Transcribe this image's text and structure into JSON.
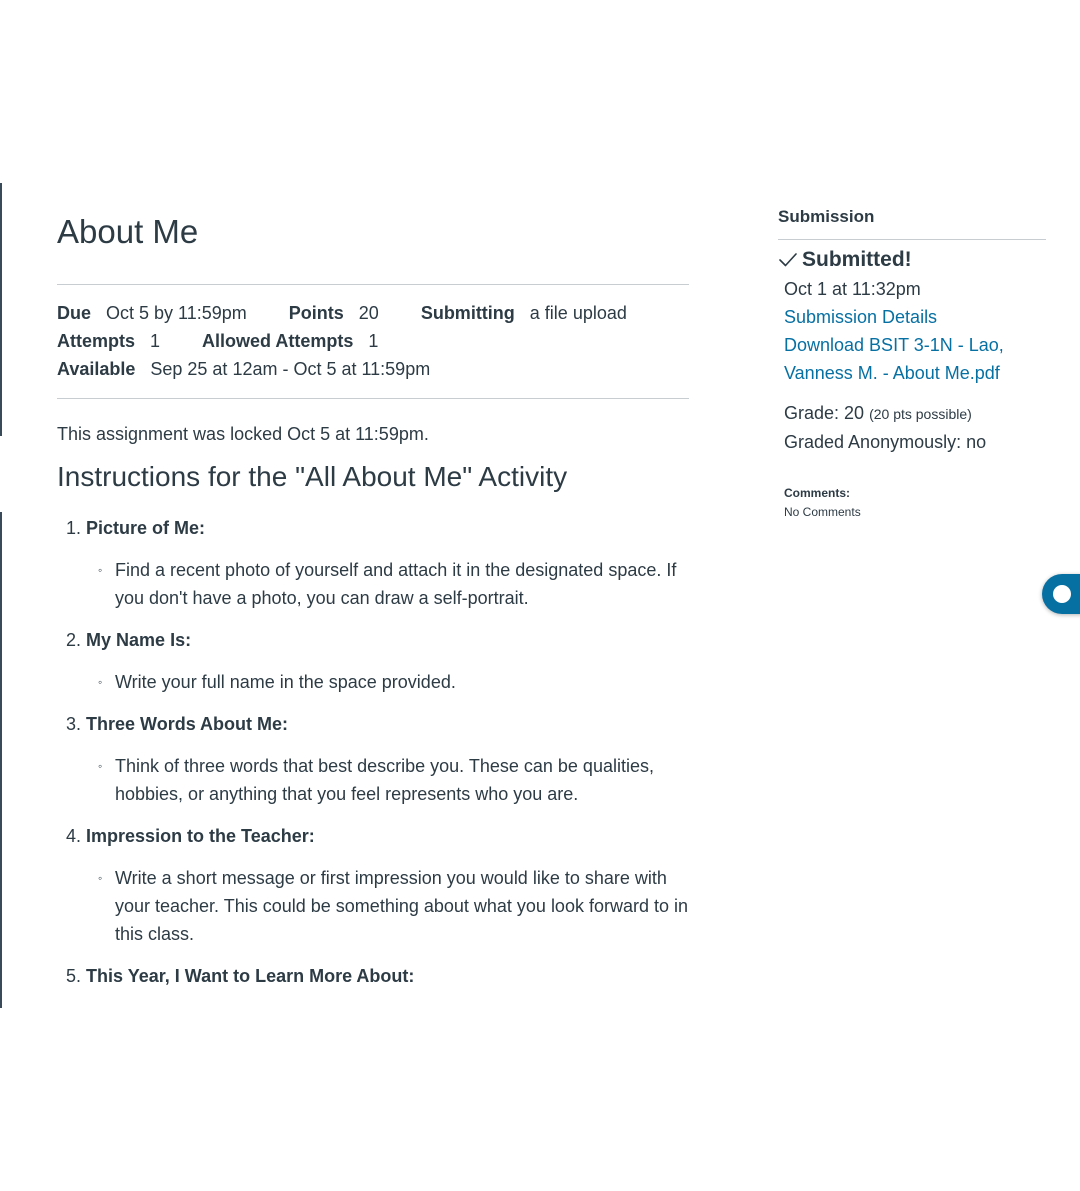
{
  "assignment": {
    "title": "About Me",
    "details": {
      "due_label": "Due",
      "due_value": "Oct 5 by 11:59pm",
      "points_label": "Points",
      "points_value": "20",
      "submitting_label": "Submitting",
      "submitting_value": "a file upload",
      "attempts_label": "Attempts",
      "attempts_value": "1",
      "allowed_label": "Allowed Attempts",
      "allowed_value": "1",
      "available_label": "Available",
      "available_value": "Sep 25 at 12am - Oct 5 at 11:59pm"
    },
    "locked_message": "This assignment was locked Oct 5 at 11:59pm.",
    "instructions_title": "Instructions for the \"All About Me\" Activity",
    "instructions": [
      {
        "number": "1.",
        "heading": "Picture of Me:",
        "bullet": "Find a recent photo of yourself and attach it in the designated space. If you don't have a photo, you can draw a self-portrait."
      },
      {
        "number": "2.",
        "heading": "My Name Is:",
        "bullet": "Write your full name in the space provided."
      },
      {
        "number": "3.",
        "heading": "Three Words About Me:",
        "bullet": "Think of three words that best describe you. These can be qualities, hobbies, or anything that you feel represents who you are."
      },
      {
        "number": "4.",
        "heading": "Impression to the Teacher:",
        "bullet": "Write a short message or first impression you would like to share with your teacher. This could be something about what you look forward to in this class."
      },
      {
        "number": "5.",
        "heading": "This Year, I Want to Learn More About:",
        "bullet": ""
      }
    ]
  },
  "sidebar": {
    "title": "Submission",
    "status": "Submitted!",
    "submitted_at": "Oct 1 at 11:32pm",
    "details_link": "Submission Details",
    "download_link": "Download BSIT 3-1N - Lao, Vanness M. - About Me.pdf",
    "grade_text": "Grade: 20",
    "grade_possible": "(20 pts possible)",
    "anonymous": "Graded Anonymously: no",
    "comments_label": "Comments:",
    "comments_value": "No Comments"
  },
  "icons": {
    "check": "checkmark-icon",
    "help": "help-chat-icon"
  },
  "colors": {
    "text": "#2d3b45",
    "link": "#0770a3",
    "help_button": "#0770a3",
    "divider": "#c7cdd1"
  }
}
